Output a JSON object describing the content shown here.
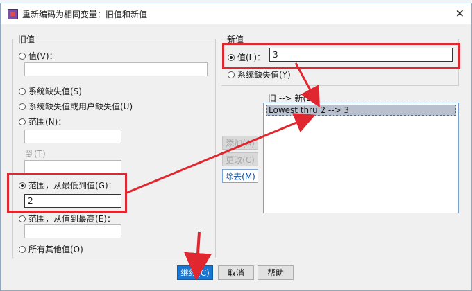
{
  "dialog": {
    "title": "重新编码为相同变量：旧值和新值",
    "close": "✕"
  },
  "old_value": {
    "group_label": "旧值",
    "value_label": "值(V)：",
    "system_missing": "系统缺失值(S)",
    "system_or_user_missing": "系统缺失值或用户缺失值(U)",
    "range_label": "范围(N)：",
    "through_label": "到(T)",
    "lowest_through_label": "范围，从最低到值(G)：",
    "lowest_through_value": "2",
    "value_through_highest_label": "范围，从值到最高(E)：",
    "all_other_values": "所有其他值(O)"
  },
  "new_value": {
    "group_label": "新值",
    "value_label": "值(L)：",
    "value": "3",
    "system_missing": "系统缺失值(Y)"
  },
  "mapping": {
    "list_label": "旧 --> 新(D)：",
    "items": [
      "Lowest thru 2 --> 3"
    ]
  },
  "buttons": {
    "add": "添加(A)",
    "change": "更改(C)",
    "remove": "除去(M)",
    "continue": "继续(C)",
    "cancel": "取消",
    "help": "帮助"
  },
  "colors": {
    "annotation": "#e0262f",
    "primary": "#1976d2"
  }
}
